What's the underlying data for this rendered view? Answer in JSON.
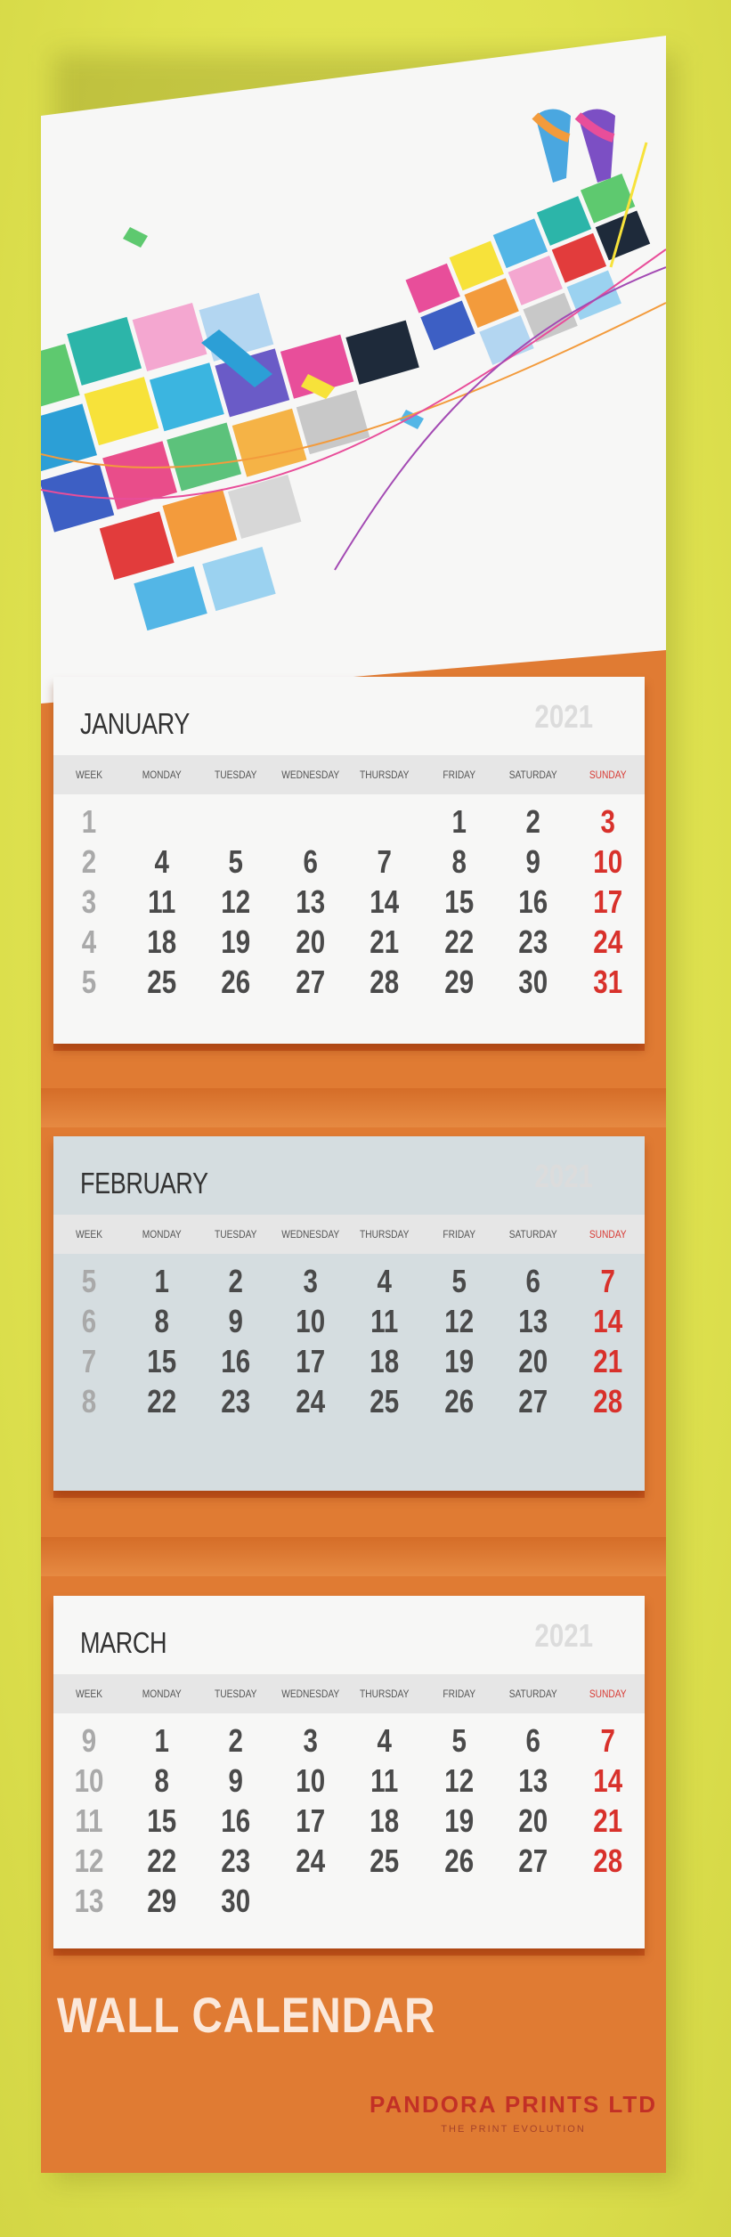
{
  "brand": {
    "name": "PANDORA PRINTS LTD",
    "tagline": "THE PRINT EVOLUTION"
  },
  "footer": {
    "title": "WALL CALENDAR"
  },
  "colors": {
    "wall": "#dfe24f",
    "board": "#e07b33",
    "sunday": "#d8312b",
    "february_pad": "#d5dde0",
    "pad": "#f7f7f6"
  },
  "weekday_labels": [
    "WEEK",
    "MONDAY",
    "TUESDAY",
    "WEDNESDAY",
    "THURSDAY",
    "FRIDAY",
    "SATURDAY",
    "SUNDAY"
  ],
  "months": [
    {
      "name": "JANUARY",
      "year": "2021",
      "rows": [
        [
          "1",
          "",
          "",
          "",
          "",
          "1",
          "2",
          "3"
        ],
        [
          "2",
          "4",
          "5",
          "6",
          "7",
          "8",
          "9",
          "10"
        ],
        [
          "3",
          "11",
          "12",
          "13",
          "14",
          "15",
          "16",
          "17"
        ],
        [
          "4",
          "18",
          "19",
          "20",
          "21",
          "22",
          "23",
          "24"
        ],
        [
          "5",
          "25",
          "26",
          "27",
          "28",
          "29",
          "30",
          "31"
        ]
      ]
    },
    {
      "name": "FEBRUARY",
      "year": "2021",
      "rows": [
        [
          "5",
          "1",
          "2",
          "3",
          "4",
          "5",
          "6",
          "7"
        ],
        [
          "6",
          "8",
          "9",
          "10",
          "11",
          "12",
          "13",
          "14"
        ],
        [
          "7",
          "15",
          "16",
          "17",
          "18",
          "19",
          "20",
          "21"
        ],
        [
          "8",
          "22",
          "23",
          "24",
          "25",
          "26",
          "27",
          "28"
        ]
      ]
    },
    {
      "name": "MARCH",
      "year": "2021",
      "rows": [
        [
          "9",
          "1",
          "2",
          "3",
          "4",
          "5",
          "6",
          "7"
        ],
        [
          "10",
          "8",
          "9",
          "10",
          "11",
          "12",
          "13",
          "14"
        ],
        [
          "11",
          "15",
          "16",
          "17",
          "18",
          "19",
          "20",
          "21"
        ],
        [
          "12",
          "22",
          "23",
          "24",
          "25",
          "26",
          "27",
          "28"
        ],
        [
          "13",
          "29",
          "30",
          "",
          "",
          "",
          "",
          ""
        ]
      ]
    }
  ]
}
